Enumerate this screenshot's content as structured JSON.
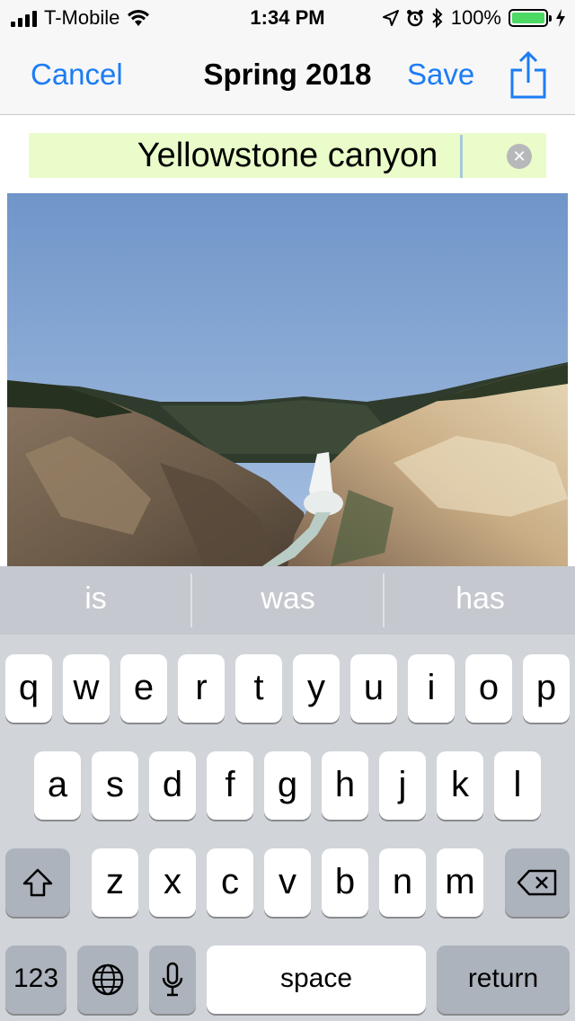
{
  "status_bar": {
    "carrier": "T-Mobile",
    "time": "1:34 PM",
    "battery": "100%"
  },
  "nav": {
    "cancel_label": "Cancel",
    "title": "Spring 2018",
    "save_label": "Save",
    "share_icon": "share-icon"
  },
  "title_field": {
    "value": "Yellowstone canyon",
    "clear_icon": "clear-icon"
  },
  "photo": {
    "icon": "photo-waterfall-canyon"
  },
  "keyboard": {
    "suggestions": [
      "is",
      "was",
      "has"
    ],
    "row1": [
      "q",
      "w",
      "e",
      "r",
      "t",
      "y",
      "u",
      "i",
      "o",
      "p"
    ],
    "row2": [
      "a",
      "s",
      "d",
      "f",
      "g",
      "h",
      "j",
      "k",
      "l"
    ],
    "row3": [
      "z",
      "x",
      "c",
      "v",
      "b",
      "n",
      "m"
    ],
    "numbers_label": "123",
    "space_label": "space",
    "return_label": "return",
    "icons": {
      "shift": "shift-icon",
      "delete": "delete-icon",
      "globe": "globe-icon",
      "mic": "microphone-icon"
    }
  },
  "colors": {
    "accent": "#1b7cf5",
    "field_highlight": "#eafcc9",
    "battery_fill": "#4cd964"
  }
}
